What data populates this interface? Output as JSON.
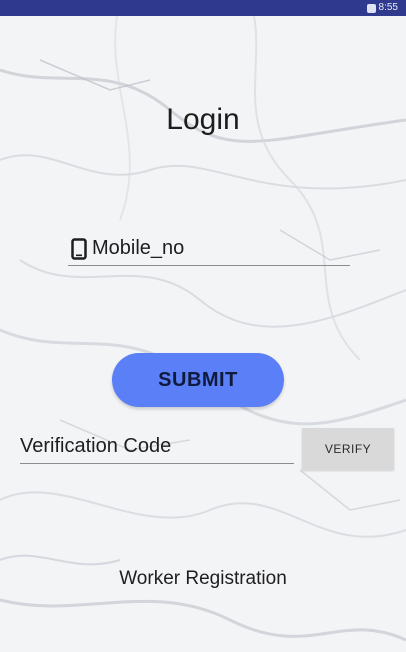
{
  "status_bar": {
    "time": "8:55",
    "color": "#2f3a8f"
  },
  "login": {
    "title": "Login",
    "mobile_field": {
      "icon": "phone-icon",
      "placeholder": "Mobile_no",
      "value": ""
    },
    "submit_label": "SUBMIT",
    "verification_field": {
      "placeholder": "Verification Code",
      "value": ""
    },
    "verify_label": "VERIFY",
    "registration_link": "Worker Registration"
  },
  "colors": {
    "submit_button": "#5b7ff6",
    "verify_button": "#d9d9d9",
    "background": "#f4f5f7"
  }
}
